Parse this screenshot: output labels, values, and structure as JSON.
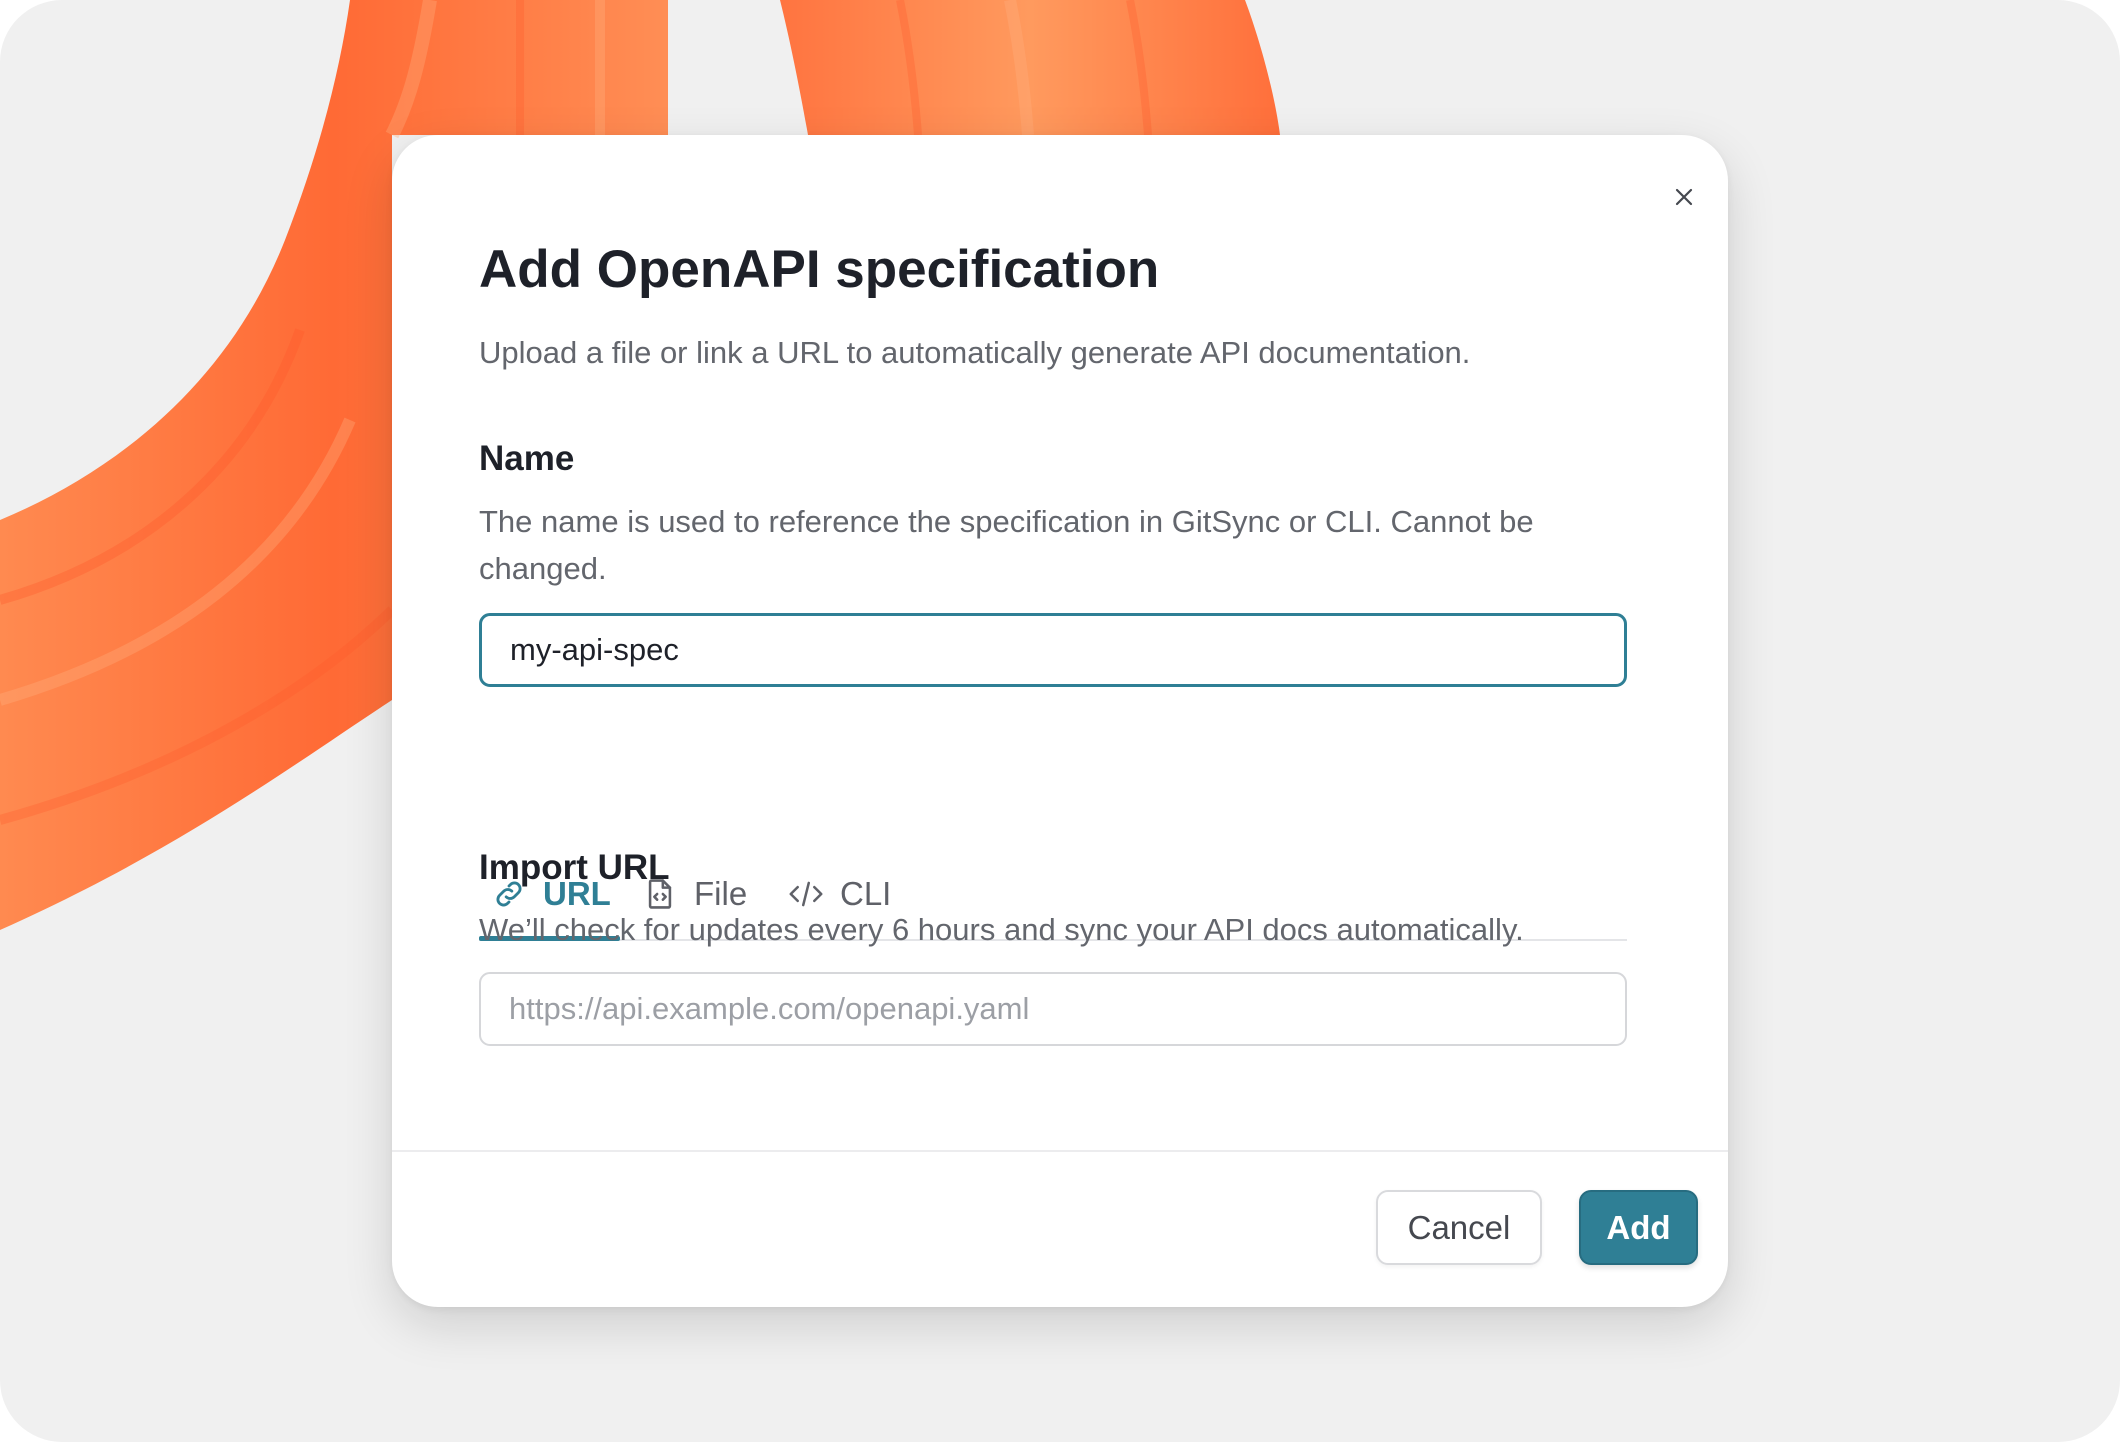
{
  "dialog": {
    "title": "Add OpenAPI specification",
    "subtitle": "Upload a file or link a URL to automatically generate API documentation.",
    "close_icon": "close-icon"
  },
  "name_section": {
    "label": "Name",
    "help": "The name is used to reference the specification in GitSync or CLI. Cannot be changed.",
    "value": "my-api-spec"
  },
  "tabs": [
    {
      "label": "URL",
      "icon": "link-icon",
      "selected": true
    },
    {
      "label": "File",
      "icon": "file-code-icon",
      "selected": false
    },
    {
      "label": "CLI",
      "icon": "code-icon",
      "selected": false
    }
  ],
  "import_section": {
    "label": "Import URL",
    "help": "We’ll check for updates every 6 hours and sync your API docs automatically.",
    "placeholder": "https://api.example.com/openapi.yaml",
    "value": ""
  },
  "footer": {
    "cancel_label": "Cancel",
    "add_label": "Add"
  },
  "colors": {
    "accent": "#2f7f95",
    "background": "#f0f0f0",
    "decoration": "#ff7a45"
  }
}
